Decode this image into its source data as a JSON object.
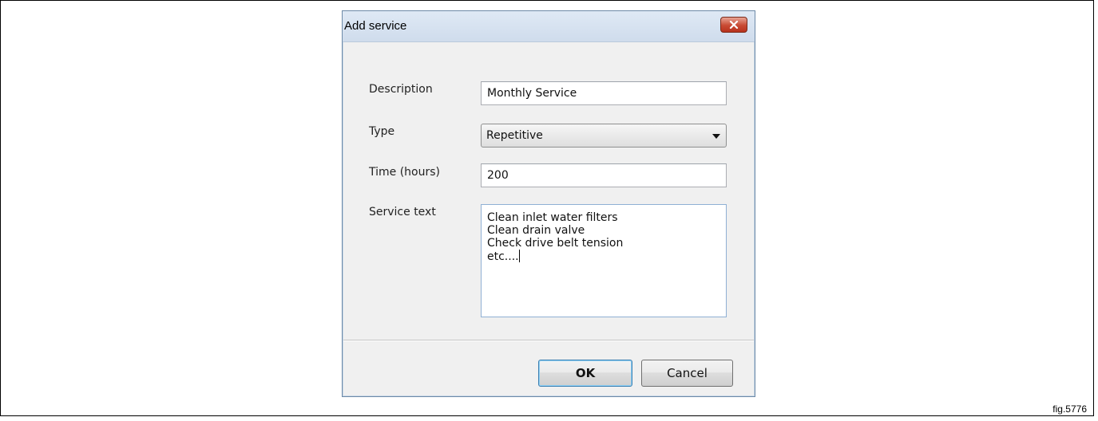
{
  "dialog": {
    "title": "Add service",
    "close_icon": "close-icon",
    "fields": {
      "description_label": "Description",
      "description_value": "Monthly Service",
      "type_label": "Type",
      "type_value": "Repetitive",
      "time_label": "Time (hours)",
      "time_value": "200",
      "service_text_label": "Service text",
      "service_text_lines": [
        "Clean inlet water filters",
        "Clean drain valve",
        "Check drive belt tension",
        "etc...."
      ]
    },
    "buttons": {
      "ok_label": "OK",
      "cancel_label": "Cancel"
    },
    "colors": {
      "close_button": "#c84a33",
      "title_bar": "#dfe9f5",
      "focus_border": "#8fb0d4"
    }
  },
  "figure": {
    "label": "fig.5776"
  }
}
